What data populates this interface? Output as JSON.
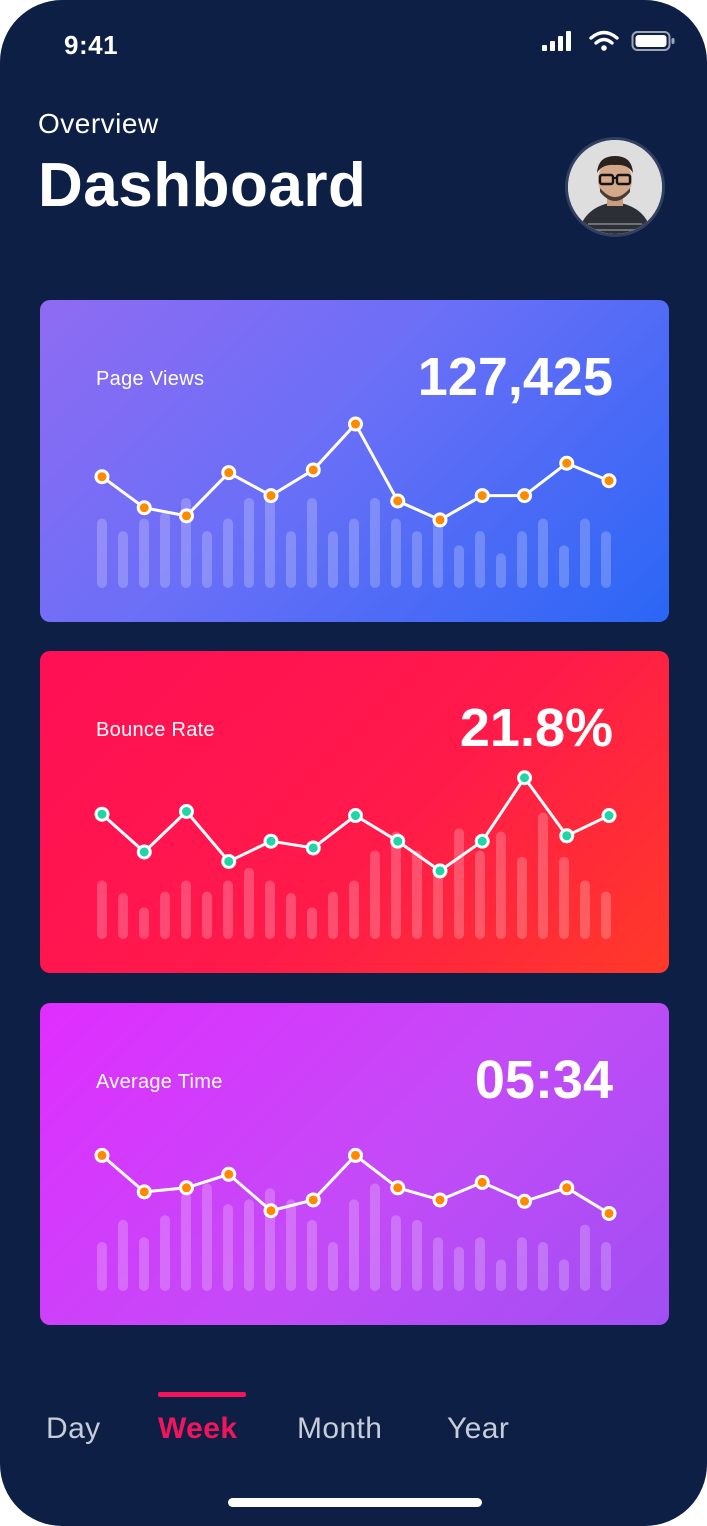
{
  "status": {
    "time": "9:41",
    "icons": [
      "signal-icon",
      "wifi-icon",
      "battery-icon"
    ]
  },
  "header": {
    "overview": "Overview",
    "title": "Dashboard",
    "avatar": "user-avatar"
  },
  "colors": {
    "background": "#0d1f45",
    "accent": "#f2155b",
    "orange_dot": "#ff8a00",
    "teal_dot": "#1fd6a4"
  },
  "cards": [
    {
      "id": "page-views",
      "label": "Page Views",
      "value": "127,425",
      "dot_color": "#ff8a00",
      "line": [
        58,
        35,
        29,
        61,
        44,
        63,
        97,
        40,
        26,
        44,
        44,
        68,
        55
      ],
      "bars": [
        44,
        36,
        44,
        48,
        57,
        36,
        44,
        57,
        62,
        36,
        57,
        36,
        44,
        57,
        44,
        36,
        44,
        27,
        36,
        22,
        36,
        44,
        27,
        44,
        36
      ]
    },
    {
      "id": "bounce-rate",
      "label": "Bounce Rate",
      "value": "21.8%",
      "dot_color": "#1fd6a4",
      "line": [
        68,
        40,
        70,
        33,
        48,
        43,
        67,
        48,
        26,
        48,
        95,
        52,
        67
      ],
      "bars": [
        37,
        29,
        20,
        30,
        37,
        30,
        37,
        45,
        37,
        29,
        20,
        30,
        37,
        56,
        68,
        56,
        44,
        70,
        56,
        68,
        52,
        80,
        52,
        37,
        30
      ]
    },
    {
      "id": "average-time",
      "label": "Average Time",
      "value": "05:34",
      "dot_color": "#ff8a00",
      "line": [
        76,
        49,
        52,
        62,
        35,
        43,
        76,
        52,
        43,
        56,
        42,
        52,
        33
      ],
      "bars": [
        31,
        45,
        34,
        48,
        62,
        68,
        55,
        58,
        65,
        58,
        45,
        31,
        58,
        68,
        48,
        45,
        34,
        28,
        34,
        20,
        34,
        31,
        20,
        42,
        31
      ]
    }
  ],
  "tabs": {
    "items": [
      "Day",
      "Week",
      "Month",
      "Year"
    ],
    "selected": "Week"
  }
}
